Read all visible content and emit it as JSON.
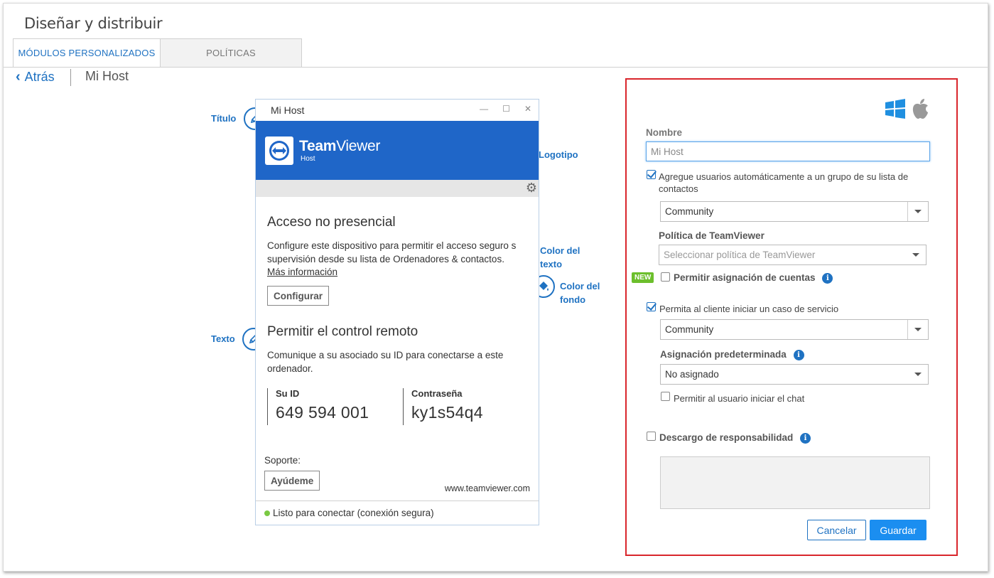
{
  "page": {
    "title": "Diseñar y distribuir"
  },
  "tabs": [
    {
      "label": "MÓDULOS PERSONALIZADOS",
      "active": true
    },
    {
      "label": "POLÍTICAS",
      "active": false
    }
  ],
  "breadcrumb": {
    "back_label": "Atrás",
    "current": "Mi Host"
  },
  "preview": {
    "window_title": "Mi Host",
    "brand_bold": "Team",
    "brand_light": "Viewer",
    "brand_sub": "Host",
    "unattended_heading": "Acceso no presencial",
    "unattended_text": "Configure este dispositivo para permitir el acceso seguro sin supervisión desde su lista de Ordenadores & contactos.",
    "more_info": "Más información",
    "configure_button": "Configurar",
    "remote_heading": "Permitir el control remoto",
    "remote_text": "Comunique a su asociado su ID para conectarse a este ordenador.",
    "id_label": "Su ID",
    "id_value": "649 594 001",
    "password_label": "Contraseña",
    "password_value": "ky1s54q4",
    "support_label": "Soporte:",
    "help_button": "Ayúdeme",
    "url": "www.teamviewer.com",
    "status": "Listo para conectar (conexión segura)",
    "status_color": "#7ac943"
  },
  "annotations": {
    "title": "Título",
    "logo": "Logotipo",
    "text_color_1": "Color del",
    "text_color_2": "texto",
    "bg_color_1": "Color del",
    "bg_color_2": "fondo",
    "text": "Texto"
  },
  "form": {
    "name_label": "Nombre",
    "name_value": "Mi Host",
    "auto_add_label_1": "Agregue usuarios automáticamente a un grupo de su lista de",
    "auto_add_label_2": "contactos",
    "auto_add_checked": true,
    "group_select": "Community",
    "policy_label": "Política de TeamViewer",
    "policy_placeholder": "Seleccionar política de TeamViewer",
    "new_badge": "NEW",
    "allow_assignment_label": "Permitir asignación de cuentas",
    "allow_assignment_checked": false,
    "service_case_label": "Permita al cliente iniciar un caso de servicio",
    "service_case_checked": true,
    "service_group_select": "Community",
    "default_assignment_label": "Asignación predeterminada",
    "default_assignment_select": "No asignado",
    "allow_chat_label": "Permitir al usuario iniciar el chat",
    "allow_chat_checked": false,
    "disclaimer_label": "Descargo de responsabilidad",
    "disclaimer_checked": false,
    "cancel_button": "Cancelar",
    "save_button": "Guardar"
  },
  "colors": {
    "accent": "#1f72c2",
    "header_blue": "#1f66c8",
    "panel_border": "#d9262c",
    "save_button": "#1b8ef0",
    "new_badge": "#6cbf2c"
  },
  "icons": [
    "windows-icon",
    "apple-icon",
    "pencil-icon",
    "image-icon",
    "brush-icon",
    "paint-bucket-icon",
    "gear-icon",
    "teamviewer-logo-icon",
    "info-icon"
  ]
}
